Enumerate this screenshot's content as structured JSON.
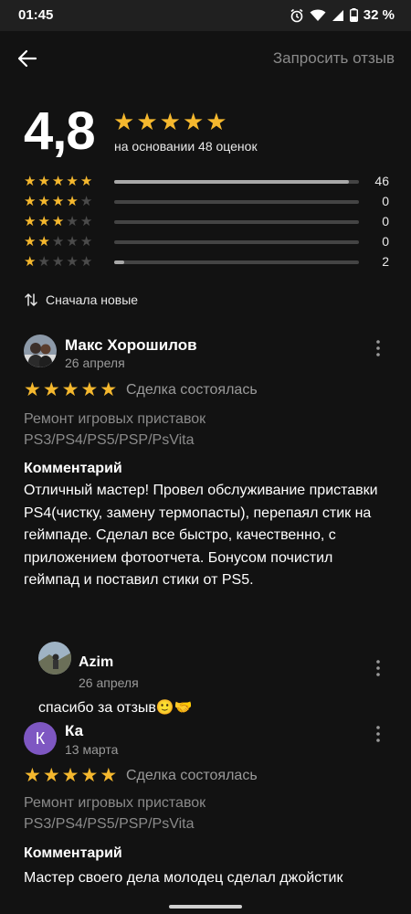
{
  "status": {
    "time": "01:45",
    "battery": "32 %"
  },
  "topbar": {
    "request_review": "Запросить отзыв"
  },
  "summary": {
    "rating": "4,8",
    "stars": 5,
    "based_on": "на основании 48 оценок"
  },
  "distribution": [
    {
      "stars": 5,
      "count": "46",
      "fraction": 0.96
    },
    {
      "stars": 4,
      "count": "0",
      "fraction": 0
    },
    {
      "stars": 3,
      "count": "0",
      "fraction": 0
    },
    {
      "stars": 2,
      "count": "0",
      "fraction": 0
    },
    {
      "stars": 1,
      "count": "2",
      "fraction": 0.04
    }
  ],
  "sort": {
    "label": "Сначала новые",
    "icon": "sort-arrows-icon"
  },
  "reviews": [
    {
      "author": "Макс Хорошилов",
      "date": "26 апреля",
      "stars": 5,
      "deal": "Сделка состоялась",
      "service": "Ремонт игровых приставок PS3/PS4/PS5/PSP/PsVita",
      "comment_heading": "Комментарий",
      "comment": "Отличный мастер! Провел обслуживание приставки PS4(чистку, замену термопасты), перепаял стик на геймпаде. Сделал все быстро, качественно, с приложением фотоотчета. Бонусом почистил геймпад и поставил стики от PS5.",
      "reply": {
        "author": "Azim",
        "date": "26 апреля",
        "text": "спасибо за отзыв🙂🤝"
      }
    },
    {
      "author": "Ка",
      "avatar_letter": "К",
      "date": "13 марта",
      "stars": 5,
      "deal": "Сделка состоялась",
      "service": "Ремонт игровых приставок PS3/PS4/PS5/PSP/PsVita",
      "comment_heading": "Комментарий",
      "comment": "Мастер своего дела молодец сделал джойстик"
    }
  ],
  "colors": {
    "star": "#f5b82e",
    "background": "#121212",
    "muted": "#9a9a9a",
    "letter_avatar": "#7e57c2"
  }
}
